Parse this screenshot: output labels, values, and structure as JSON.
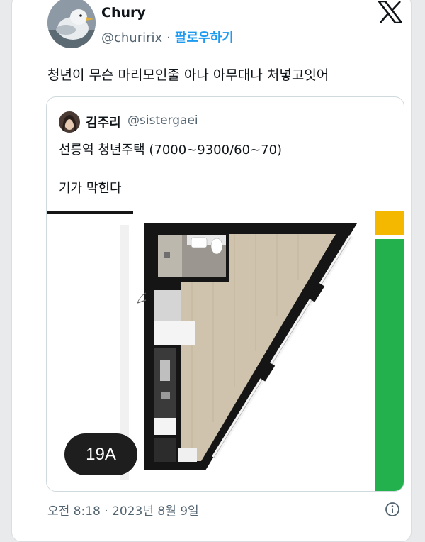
{
  "tweet": {
    "author_name": "Chury",
    "author_handle": "@churirix",
    "separator": "·",
    "follow_label": "팔로우하기",
    "text": "청년이 무슨 마리모인줄 아나 아무대나 처넣고잇어",
    "timestamp": "오전 8:18 · 2023년 8월 9일",
    "avatar_icon": "seagull-avatar",
    "logo_icon": "x-logo-icon",
    "info_icon": "info-icon"
  },
  "quoted": {
    "author_name": "김주리",
    "author_handle": "@sistergaei",
    "line1": "선릉역 청년주택 (7000~9300/60~70)",
    "line2": "기가 막힌다",
    "unit_label": "19A"
  },
  "colors": {
    "link": "#1d9bf0",
    "muted": "#536471",
    "bar_green": "#22b14c",
    "bar_yellow": "#f5b800",
    "floor": "#cfc3ad",
    "wall": "#151515"
  }
}
